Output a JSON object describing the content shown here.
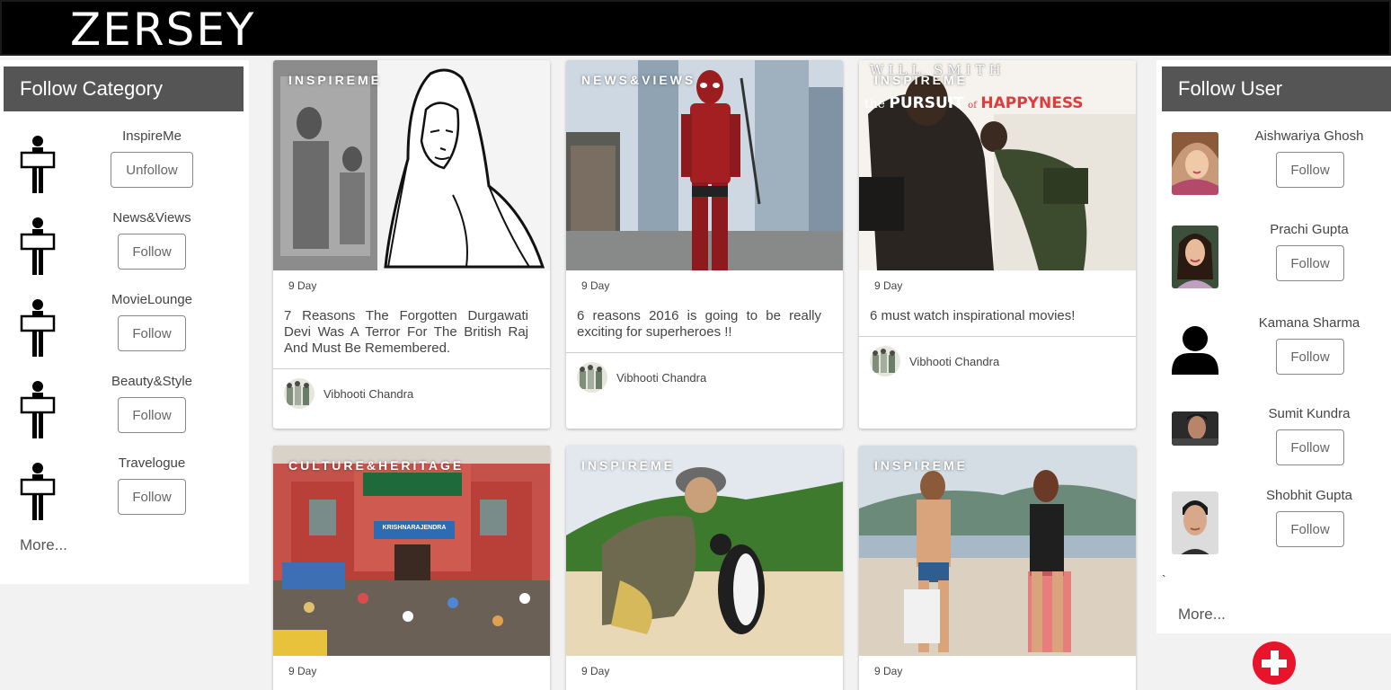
{
  "header": {
    "logo": "ZERSEY"
  },
  "left_sidebar": {
    "title": "Follow Category",
    "categories": [
      {
        "label": "InspireMe",
        "button": "Unfollow",
        "icon": "person-sign-icon"
      },
      {
        "label": "News&Views",
        "button": "Follow",
        "icon": "person-sign-icon"
      },
      {
        "label": "MovieLounge",
        "button": "Follow",
        "icon": "person-sign-icon"
      },
      {
        "label": "Beauty&Style",
        "button": "Follow",
        "icon": "person-sign-icon"
      },
      {
        "label": "Travelogue",
        "button": "Follow",
        "icon": "person-sign-icon"
      }
    ],
    "more": "More..."
  },
  "right_sidebar": {
    "title": "Follow User",
    "users": [
      {
        "name": "Aishwariya Ghosh",
        "button": "Follow"
      },
      {
        "name": "Prachi Gupta",
        "button": "Follow"
      },
      {
        "name": "Kamana Sharma",
        "button": "Follow"
      },
      {
        "name": "Sumit Kundra",
        "button": "Follow"
      },
      {
        "name": "Shobhit Gupta",
        "button": "Follow"
      }
    ],
    "stray_mark": "`",
    "more": "More..."
  },
  "feed": {
    "cards": [
      {
        "category": "INSPIREME",
        "day": "9 Day",
        "title": "7 Reasons The Forgotten Durgawati Devi Was A Terror For The British Raj And Must Be Remembered.",
        "author": "Vibhooti Chandra"
      },
      {
        "category": "NEWS&VIEWS",
        "day": "9 Day",
        "title": "6 reasons 2016 is going to be really exciting for superheroes !!",
        "author": "Vibhooti Chandra"
      },
      {
        "category": "INSPIREME",
        "day": "9 Day",
        "title": "6 must watch inspirational movies!",
        "author": "Vibhooti Chandra",
        "poster_top": "WILL SMITH",
        "poster_the": "the",
        "poster_pursuit": "PURSUIT",
        "poster_of": "of",
        "poster_happyness": "HAPPYNESS"
      },
      {
        "category": "CULTURE&HERITAGE",
        "day": "9 Day",
        "sign": "KRISHNARAJENDRA"
      },
      {
        "category": "INSPIREME",
        "day": "9 Day"
      },
      {
        "category": "INSPIREME",
        "day": "9 Day"
      }
    ]
  },
  "fab": {
    "icon": "plus-icon",
    "color": "#e8142b"
  }
}
